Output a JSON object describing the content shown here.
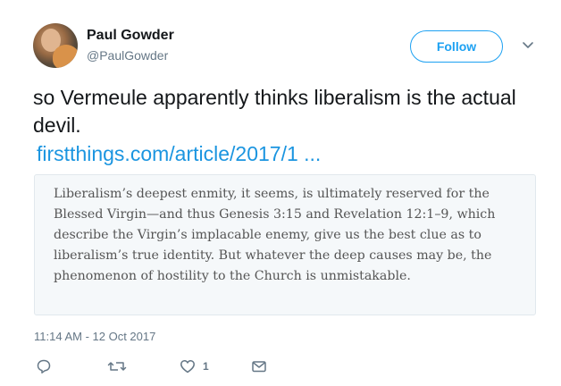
{
  "author": {
    "name": "Paul Gowder",
    "handle": "@PaulGowder"
  },
  "header": {
    "follow_label": "Follow",
    "caret_icon": "chevron-down-icon"
  },
  "tweet": {
    "text": "so Vermeule apparently thinks liberalism is the actual devil.",
    "link": "firstthings.com/article/2017/1 ...",
    "quote": "Liberalism’s deepest enmity, it seems, is ultimately reserved for the Blessed Virgin—and thus Genesis 3:15 and Revelation 12:1–9, which describe the Virgin’s implacable enemy, give us the best clue as to liberalism’s true identity. But whatever the deep causes may be, the phenomenon of hostility to the Church is unmistakable.",
    "timestamp": "11:14 AM - 12 Oct 2017"
  },
  "actions": {
    "reply_icon": "reply-icon",
    "retweet_icon": "retweet-icon",
    "like_icon": "heart-icon",
    "like_count": "1",
    "dm_icon": "envelope-icon"
  },
  "colors": {
    "accent": "#1da1f2",
    "link": "#1b95e0",
    "muted": "#657786"
  }
}
